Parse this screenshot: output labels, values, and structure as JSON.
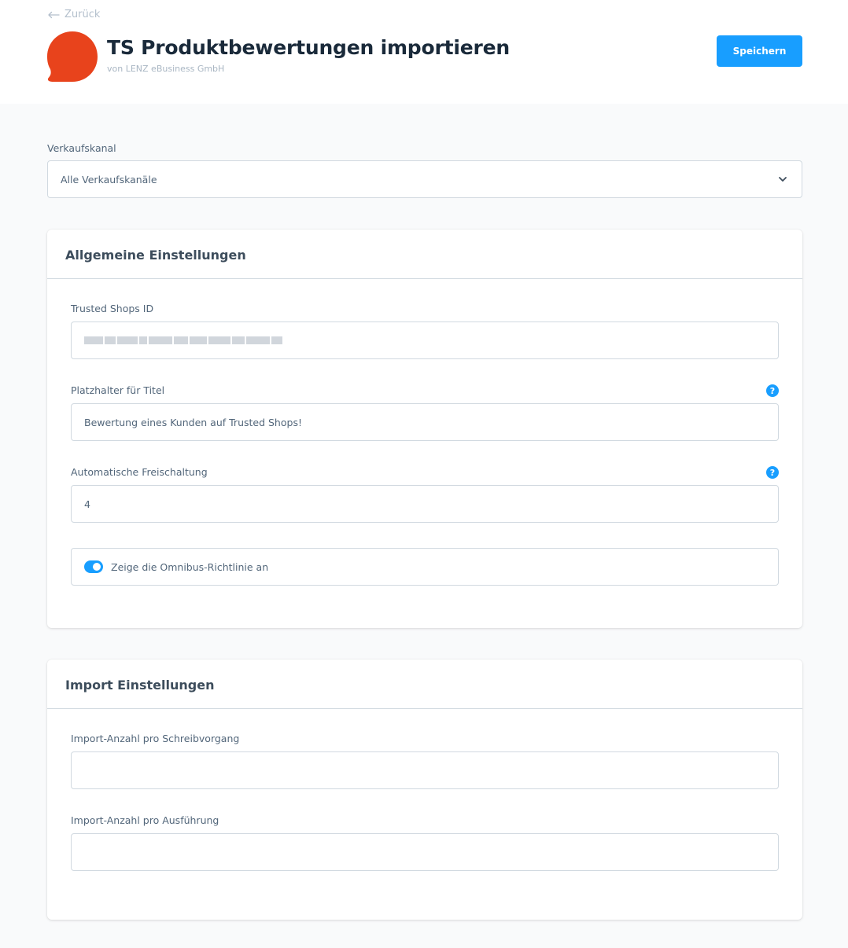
{
  "header": {
    "back_label": "Zurück",
    "title": "TS Produktbewertungen importieren",
    "vendor": "von LENZ eBusiness GmbH",
    "save_label": "Speichern",
    "logo_color": "#e8431c",
    "accent_color": "#189eff"
  },
  "sales_channel": {
    "label": "Verkaufskanal",
    "selected": "Alle Verkaufskanäle"
  },
  "general_settings": {
    "title": "Allgemeine Einstellungen",
    "trusted_shops_id": {
      "label": "Trusted Shops ID",
      "value_redacted": true
    },
    "title_placeholder": {
      "label": "Platzhalter für Titel",
      "value": "Bewertung eines Kunden auf Trusted Shops!",
      "help_icon": "?"
    },
    "auto_release": {
      "label": "Automatische Freischaltung",
      "value": "4",
      "help_icon": "?"
    },
    "omnibus_toggle": {
      "label": "Zeige die Omnibus-Richtlinie an",
      "enabled": true
    }
  },
  "import_settings": {
    "title": "Import Einstellungen",
    "per_write": {
      "label": "Import-Anzahl pro Schreibvorgang",
      "value": ""
    },
    "per_run": {
      "label": "Import-Anzahl pro Ausführung",
      "value": ""
    }
  }
}
